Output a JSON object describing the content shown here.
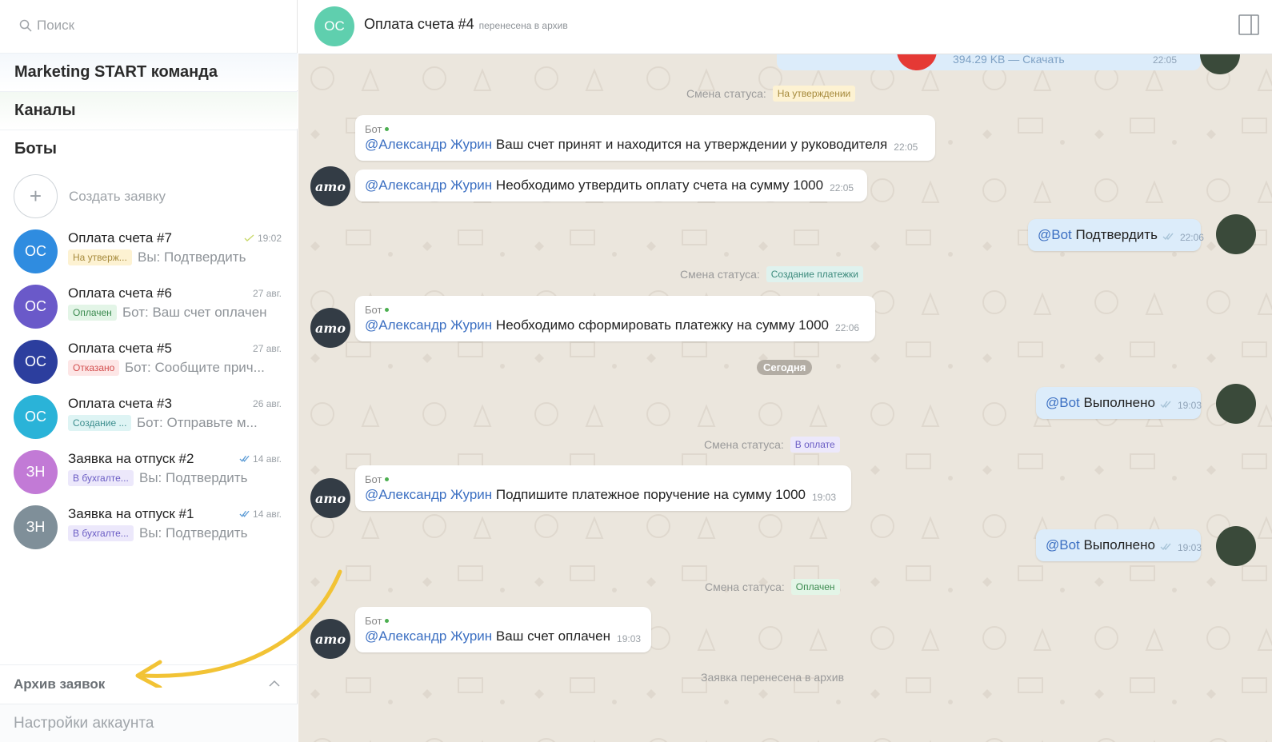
{
  "sidebar": {
    "search_placeholder": "Поиск",
    "sections": [
      "Marketing START команда",
      "Каналы",
      "Боты"
    ],
    "create_label": "Создать заявку",
    "chats": [
      {
        "initials": "ОС",
        "title": "Оплата счета #7",
        "time": "19:02",
        "checks": "single",
        "badge": "На утверж...",
        "badge_bg": "#fdf2d2",
        "badge_fg": "#a68a3c",
        "preview": "Вы: Подтвердить",
        "avatar_color": "#2f8ce0"
      },
      {
        "initials": "ОС",
        "title": "Оплата счета #6",
        "time": "27 авг.",
        "checks": "none",
        "badge": "Оплачен",
        "badge_bg": "#e3f5e7",
        "badge_fg": "#3b8a4f",
        "preview": "Бот: Ваш счет оплачен",
        "avatar_color": "#6a59c9"
      },
      {
        "initials": "ОС",
        "title": "Оплата счета #5",
        "time": "27 авг.",
        "checks": "none",
        "badge": "Отказано",
        "badge_bg": "#fde6e6",
        "badge_fg": "#d35050",
        "preview": "Бот: Сообщите прич...",
        "avatar_color": "#2c3e9e"
      },
      {
        "initials": "ОС",
        "title": "Оплата счета #3",
        "time": "26 авг.",
        "checks": "none",
        "badge": "Создание ...",
        "badge_bg": "#def4f4",
        "badge_fg": "#3c8e8e",
        "preview": "Бот: Отправьте м...",
        "avatar_color": "#2ab3d8"
      },
      {
        "initials": "ЗН",
        "title": "Заявка на отпуск #2",
        "time": "14 авг.",
        "checks": "double",
        "badge": "В бухгалте...",
        "badge_bg": "#ece8fb",
        "badge_fg": "#6a5cc4",
        "preview": "Вы: Подтвердить",
        "avatar_color": "#c27ad6"
      },
      {
        "initials": "ЗН",
        "title": "Заявка на отпуск #1",
        "time": "14 авг.",
        "checks": "double",
        "badge": "В бухгалте...",
        "badge_bg": "#ece8fb",
        "badge_fg": "#6a5cc4",
        "preview": "Вы: Подтвердить",
        "avatar_color": "#7f8f99"
      }
    ],
    "archive_label": "Архив заявок",
    "settings_label": "Настройки аккаунта"
  },
  "header": {
    "initials": "ОС",
    "title": "Оплата счета #4",
    "subtitle": "перенесена в архив"
  },
  "conversation": {
    "top_partial": {
      "text": "394.29 KB — Скачать",
      "time": "22:05"
    },
    "status_label": "Смена статуса:",
    "status_1": {
      "text": "На утверждении",
      "bg": "#fdf2d2",
      "fg": "#a68a3c"
    },
    "bot_name": "Бот",
    "bot_avatar_text": "amo",
    "mention": "@Александр Журин",
    "bot_msg_1": {
      "text": " Ваш счет принят и находится на утверждении у руководителя",
      "time": "22:05"
    },
    "bot_msg_2": {
      "text": " Необходимо утвердить оплату счета на сумму 1000",
      "time": "22:05"
    },
    "bot_mention": "@Bot",
    "user_msg_1": {
      "text": " Подтвердить",
      "time": "22:06"
    },
    "status_2": {
      "text": "Создание платежки",
      "bg": "#dff2ee",
      "fg": "#3c8a7c"
    },
    "bot_msg_3": {
      "text": " Необходимо сформировать платежку на сумму 1000",
      "time": "22:06"
    },
    "day_divider": "Сегодня",
    "user_msg_2": {
      "text": " Выполнено",
      "time": "19:03"
    },
    "status_3": {
      "text": "В оплате",
      "bg": "#ece8fb",
      "fg": "#6a5cc4"
    },
    "bot_msg_4": {
      "text": " Подпишите платежное поручение на сумму 1000",
      "time": "19:03"
    },
    "user_msg_3": {
      "text": " Выполнено",
      "time": "19:03"
    },
    "status_4": {
      "text": "Оплачен",
      "bg": "#e3f5e7",
      "fg": "#3b8a4f"
    },
    "bot_msg_5": {
      "text": " Ваш счет оплачен",
      "time": "19:03"
    },
    "archived_note": "Заявка перенесена в архив"
  },
  "colors": {
    "accent_link": "#3b6fc2",
    "arrow": "#f2c335",
    "chat_bg": "#ebe6dd"
  }
}
